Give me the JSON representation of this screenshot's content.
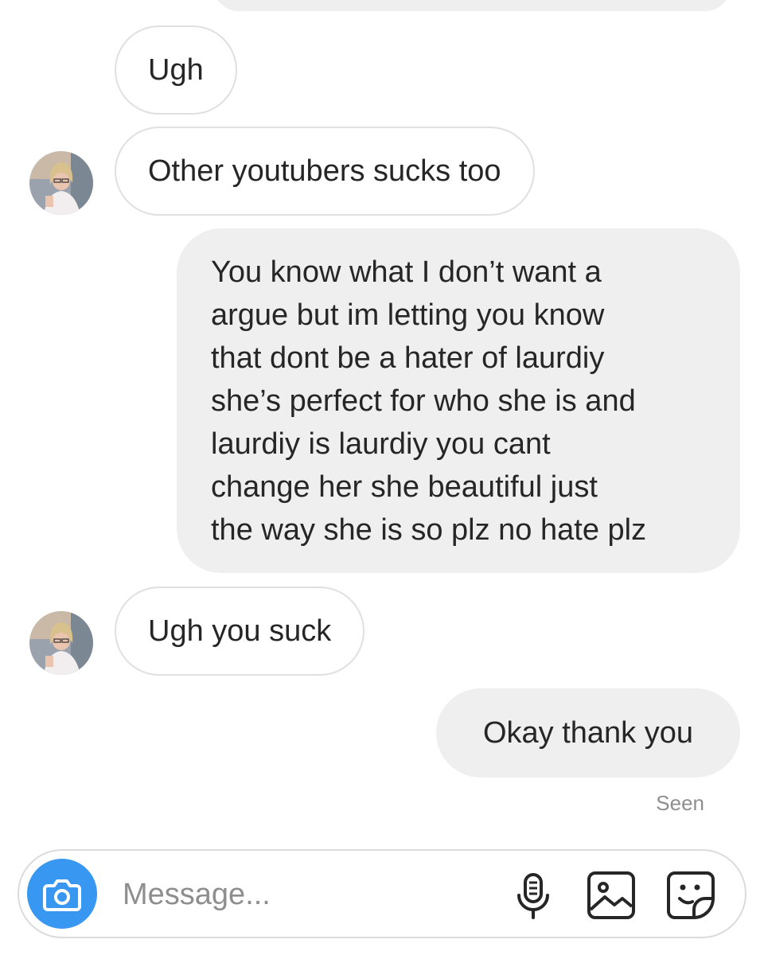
{
  "conversation": {
    "messages": [
      {
        "sender": "other",
        "text": "Ugh"
      },
      {
        "sender": "other",
        "text": "Other youtubers sucks too"
      },
      {
        "sender": "me",
        "lines": [
          "You know what I don’t want a",
          "argue but im letting you know",
          "that dont be a hater of laurdiy",
          "she’s perfect for who she is and",
          "laurdiy is laurdiy you cant",
          "change her she beautiful just",
          "the way she is so plz no hate plz"
        ]
      },
      {
        "sender": "other",
        "text": "Ugh you suck"
      },
      {
        "sender": "me",
        "text": "Okay thank you"
      }
    ],
    "seen_label": "Seen"
  },
  "composer": {
    "placeholder": "Message...",
    "icons": [
      "camera-icon",
      "microphone-icon",
      "gallery-icon",
      "sticker-icon"
    ]
  },
  "colors": {
    "accent": "#3897f0",
    "outgoing_bubble": "#efefef",
    "incoming_border": "#e0e0e0",
    "text": "#262626",
    "muted": "#8e8e8e"
  }
}
